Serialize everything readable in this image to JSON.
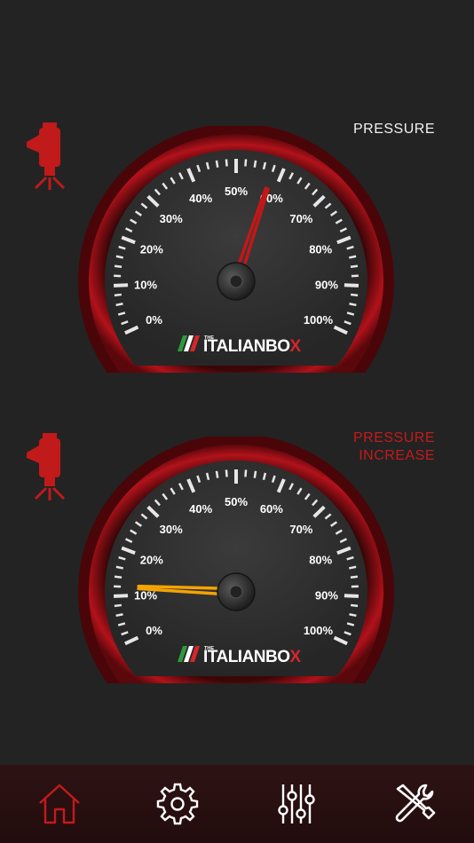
{
  "gauges": [
    {
      "label": "PRESSURE",
      "value_percent": 58,
      "needle_color": "#c41717",
      "ticks": [
        "0%",
        "10%",
        "20%",
        "30%",
        "40%",
        "50%",
        "60%",
        "70%",
        "80%",
        "90%",
        "100%"
      ],
      "brand": {
        "the": "THE",
        "name": "ITALIANBO",
        "x": "X"
      }
    },
    {
      "label": "PRESSURE\nINCREASE",
      "value_percent": 12,
      "needle_color": "#f4a400",
      "ticks": [
        "0%",
        "10%",
        "20%",
        "30%",
        "40%",
        "50%",
        "60%",
        "70%",
        "80%",
        "90%",
        "100%"
      ],
      "brand": {
        "the": "THE",
        "name": "ITALIANBO",
        "x": "X"
      }
    }
  ],
  "colors": {
    "accent_red": "#c61a1a",
    "background": "#232323",
    "tabbar": "#2a1011"
  },
  "tabbar": {
    "items": [
      {
        "name": "home",
        "icon": "home-icon",
        "active": true
      },
      {
        "name": "settings",
        "icon": "gear-icon",
        "active": false
      },
      {
        "name": "adjust",
        "icon": "sliders-icon",
        "active": false
      },
      {
        "name": "tools",
        "icon": "tools-icon",
        "active": false
      }
    ]
  }
}
